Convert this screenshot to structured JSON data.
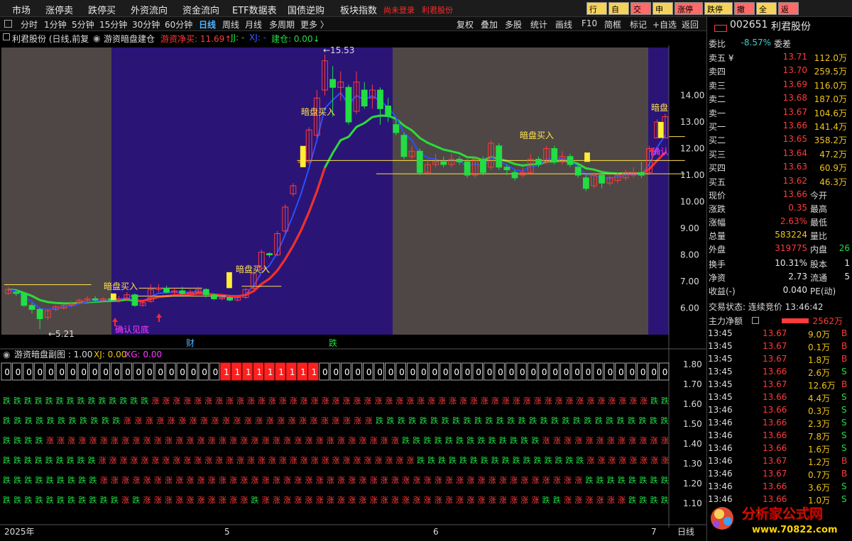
{
  "menubar": {
    "items": [
      "市场",
      "涨停卖",
      "跌停买",
      "外资流向",
      "资金流向",
      "ETF数据表",
      "国债逆购",
      "板块指数"
    ],
    "warning": "尚未登录",
    "stock_short": "利君股份",
    "buttons": [
      {
        "label": "行情",
        "bg": "#f5d35a"
      },
      {
        "label": "自选",
        "bg": "#f5d35a"
      },
      {
        "label": "交易",
        "bg": "#ff6a6a"
      },
      {
        "label": "申新",
        "bg": "#f5d35a"
      },
      {
        "label": "涨停买",
        "bg": "#ff6a6a"
      },
      {
        "label": "跌停卖",
        "bg": "#f5d35a"
      },
      {
        "label": "撤单",
        "bg": "#ff6a6a"
      },
      {
        "label": "全撤",
        "bg": "#f5d35a"
      },
      {
        "label": "返回",
        "bg": "#ff6a6a"
      }
    ]
  },
  "toolbar": {
    "periods": [
      "分时",
      "1分钟",
      "5分钟",
      "15分钟",
      "30分钟",
      "60分钟",
      "日线",
      "周线",
      "月线",
      "多周期",
      "更多 〉"
    ],
    "selected": "日线",
    "right": [
      "复权",
      "叠加",
      "多股",
      "统计",
      "画线",
      "F10",
      "简框",
      "标记",
      "+自选",
      "返回"
    ]
  },
  "chart_header": {
    "title": "利君股份 (日线,前复权)",
    "indicator": "游资暗盘建仓",
    "net_buy_label": "游资净买: 11.69↑",
    "jj": "JJ: -",
    "xj": "XJ: -",
    "build": "建仓: 0.00↓"
  },
  "price_axis": {
    "labels": [
      "14.00",
      "13.00",
      "12.00",
      "11.00",
      "10.00",
      "9.00",
      "8.00",
      "7.00",
      "6.00"
    ]
  },
  "annotations": {
    "high": "←15.53",
    "low": "←5.21",
    "buy": "暗盘买入",
    "confirm_bottom": "确认见底",
    "confirm": "确认",
    "dark": "暗盘",
    "cai": "财",
    "die": "跌"
  },
  "sub_header": {
    "title": "游资暗盘副图 : 1.00",
    "xj": "XJ: 0.00",
    "xg": "XG: 0.00"
  },
  "sub_axis": {
    "labels": [
      "1.80",
      "1.70",
      "1.60",
      "1.50",
      "1.40",
      "1.30",
      "1.20",
      "1.10"
    ]
  },
  "binary_row": "0000000000000000000011111111100000000000000000000000000000000",
  "signal_rows": [
    "GGGGGGGGGGGGGGRRRRRRRRRRRRRRRRRRRRRRRRRRRRRRRRRRRRRRRRRRRRRRRGG",
    "GGGGGGGGGGGRRRRRRRRRRRRRRRRRRRRRRRGGGGGGGGGGGGGGGGGGGGGGGGGGG",
    "GGGGRRRRRRRRRRRRRRRRRRRRRRRRRRRRRRRRRGGGGGGGGGGGGGRRRRRRRRRRRR",
    "GGGGGGGGGRRRRRRRRRRRRRRRRRRRRRRRRRRRRRRGGGGGGGGGGGGGGGGRRRRRRRR",
    "GGGGGGGGGRRRRRRRRRRRRRRRRRRRRRRRRRRRRRRRRRRRRRRRRRRRRRGGGGGGGG",
    "GGGGGGGGGGGRGRRRRRRRRRRGRRRRRRRRRRRRRRRRRRRRRRRRRRGGRRRRRRGGGG"
  ],
  "signal_words": {
    "G": "跌",
    "R": "涨"
  },
  "time_axis": {
    "labels": [
      "2025年",
      "5",
      "6",
      "7"
    ],
    "period": "日线"
  },
  "quote": {
    "code": "002651",
    "name": "利君股份",
    "webi": {
      "label": "委比",
      "value": "-8.57%",
      "label2": "委差"
    },
    "sells": [
      {
        "label": "卖五 ¥",
        "price": "13.71",
        "vol": "112.0万"
      },
      {
        "label": "卖四",
        "price": "13.70",
        "vol": "259.5万"
      },
      {
        "label": "卖三",
        "price": "13.69",
        "vol": "116.0万"
      },
      {
        "label": "卖二",
        "price": "13.68",
        "vol": "187.0万"
      },
      {
        "label": "卖一",
        "price": "13.67",
        "vol": "104.6万"
      }
    ],
    "buys": [
      {
        "label": "买一",
        "price": "13.66",
        "vol": "141.4万"
      },
      {
        "label": "买二",
        "price": "13.65",
        "vol": "358.2万"
      },
      {
        "label": "买三",
        "price": "13.64",
        "vol": "47.2万"
      },
      {
        "label": "买四",
        "price": "13.63",
        "vol": "60.9万"
      },
      {
        "label": "买五",
        "price": "13.62",
        "vol": "46.3万"
      }
    ],
    "stats": [
      {
        "l": "现价",
        "v": "13.66",
        "r": "今开",
        "c": "red"
      },
      {
        "l": "涨跌",
        "v": "0.35",
        "r": "最高",
        "c": "red"
      },
      {
        "l": "涨幅",
        "v": "2.63%",
        "r": "最低",
        "c": "red"
      },
      {
        "l": "总量",
        "v": "583224",
        "r": "量比",
        "c": "yel"
      },
      {
        "l": "外盘",
        "v": "319775",
        "r": "内盘",
        "c": "red",
        "rv": "26"
      }
    ],
    "stats2": [
      {
        "l": "换手",
        "v": "10.31%",
        "r": "股本",
        "rv": "1"
      },
      {
        "l": "净资",
        "v": "2.73",
        "r": "流通",
        "rv": "5"
      },
      {
        "l": "收益(-)",
        "v": "0.040",
        "r": "PE(动)",
        "rv": ""
      }
    ],
    "trade_state": "交易状态: 连续竞价 13:46:42",
    "main_net": {
      "label": "主力净额",
      "value": "2562万"
    },
    "ticks": [
      [
        "13:45",
        "13.67",
        "9.0万",
        "B"
      ],
      [
        "13:45",
        "13.67",
        "0.1万",
        "B"
      ],
      [
        "13:45",
        "13.67",
        "1.8万",
        "B"
      ],
      [
        "13:45",
        "13.66",
        "2.6万",
        "S"
      ],
      [
        "13:45",
        "13.67",
        "12.6万",
        "B"
      ],
      [
        "13:45",
        "13.66",
        "4.4万",
        "S"
      ],
      [
        "13:46",
        "13.66",
        "0.3万",
        "S"
      ],
      [
        "13:46",
        "13.66",
        "2.3万",
        "S"
      ],
      [
        "13:46",
        "13.66",
        "7.8万",
        "S"
      ],
      [
        "13:46",
        "13.66",
        "1.6万",
        "S"
      ],
      [
        "13:46",
        "13.67",
        "1.2万",
        "B"
      ],
      [
        "13:46",
        "13.67",
        "0.7万",
        "B"
      ],
      [
        "13:46",
        "13.66",
        "3.6万",
        "S"
      ],
      [
        "13:46",
        "13.66",
        "1.0万",
        "S"
      ]
    ]
  },
  "watermark": {
    "text": "分析家公式网",
    "url": "www.70822.com"
  },
  "chart_data": {
    "type": "candlestick",
    "ylim": [
      5.0,
      15.8
    ],
    "candles": [
      [
        6.55,
        6.7,
        6.8,
        6.5
      ],
      [
        6.6,
        6.55,
        6.7,
        6.45
      ],
      [
        6.55,
        6.1,
        6.6,
        6.05
      ],
      [
        6.1,
        5.95,
        6.2,
        5.8
      ],
      [
        5.95,
        5.6,
        6.0,
        5.21
      ],
      [
        5.65,
        5.9,
        5.95,
        5.55
      ],
      [
        5.95,
        6.05,
        6.1,
        5.9
      ],
      [
        6.0,
        6.1,
        6.15,
        5.95
      ],
      [
        6.1,
        6.15,
        6.25,
        6.05
      ],
      [
        6.2,
        6.3,
        6.35,
        6.15
      ],
      [
        6.3,
        6.35,
        6.45,
        6.2
      ],
      [
        6.35,
        6.3,
        6.45,
        6.25
      ],
      [
        6.3,
        6.35,
        6.4,
        6.25
      ],
      [
        6.35,
        6.3,
        6.45,
        6.25
      ],
      [
        6.3,
        6.35,
        6.45,
        6.2
      ],
      [
        6.35,
        6.5,
        6.6,
        6.25
      ],
      [
        6.5,
        6.1,
        6.55,
        6.05
      ],
      [
        6.1,
        6.2,
        6.3,
        6.05
      ],
      [
        6.25,
        6.7,
        6.9,
        6.2
      ],
      [
        6.7,
        6.75,
        6.9,
        6.6
      ],
      [
        6.75,
        6.6,
        6.85,
        6.55
      ],
      [
        6.6,
        6.65,
        6.75,
        6.5
      ],
      [
        6.65,
        6.55,
        6.8,
        6.5
      ],
      [
        6.55,
        6.6,
        6.7,
        6.5
      ],
      [
        6.6,
        6.7,
        6.8,
        6.55
      ],
      [
        6.7,
        6.5,
        6.75,
        6.4
      ],
      [
        6.5,
        6.35,
        6.55,
        6.3
      ],
      [
        6.35,
        6.4,
        6.45,
        6.3
      ],
      [
        6.4,
        6.3,
        6.45,
        6.25
      ],
      [
        6.3,
        6.4,
        6.5,
        6.25
      ],
      [
        6.4,
        6.7,
        6.75,
        6.35
      ],
      [
        6.75,
        7.3,
        7.4,
        6.7
      ],
      [
        7.5,
        8.1,
        8.2,
        7.4
      ],
      [
        8.05,
        8.0,
        8.1,
        7.9
      ],
      [
        8.0,
        8.8,
        8.9,
        7.95
      ],
      [
        8.9,
        9.8,
        9.9,
        8.8
      ],
      [
        10.3,
        10.6,
        10.7,
        10.2
      ],
      [
        11.5,
        11.5,
        11.6,
        11.4
      ],
      [
        11.5,
        12.7,
        12.8,
        11.4
      ],
      [
        12.5,
        13.9,
        14.2,
        12.4
      ],
      [
        14.2,
        15.3,
        15.53,
        14.0
      ],
      [
        14.6,
        14.3,
        15.1,
        13.2
      ],
      [
        14.3,
        14.5,
        14.9,
        13.8
      ],
      [
        14.3,
        13.0,
        14.4,
        12.9
      ],
      [
        13.4,
        14.5,
        14.9,
        13.3
      ],
      [
        14.2,
        13.6,
        14.5,
        13.5
      ],
      [
        13.9,
        14.2,
        14.4,
        13.5
      ],
      [
        14.2,
        13.5,
        14.3,
        12.9
      ],
      [
        13.6,
        13.2,
        13.9,
        13.0
      ],
      [
        12.9,
        12.6,
        13.1,
        12.5
      ],
      [
        12.5,
        11.7,
        12.6,
        11.6
      ],
      [
        11.7,
        11.9,
        12.1,
        11.6
      ],
      [
        11.9,
        11.1,
        12.0,
        11.0
      ],
      [
        11.1,
        11.4,
        11.6,
        11.0
      ],
      [
        11.4,
        11.5,
        11.8,
        11.3
      ],
      [
        11.5,
        11.4,
        11.7,
        11.3
      ],
      [
        11.4,
        11.6,
        11.8,
        11.3
      ],
      [
        11.6,
        11.5,
        11.7,
        11.4
      ],
      [
        11.5,
        11.0,
        11.6,
        10.9
      ],
      [
        11.0,
        11.6,
        11.7,
        10.9
      ],
      [
        11.6,
        11.1,
        11.7,
        11.0
      ],
      [
        11.3,
        12.2,
        12.3,
        11.2
      ],
      [
        12.1,
        11.3,
        12.2,
        11.2
      ],
      [
        11.3,
        11.2,
        11.4,
        11.0
      ],
      [
        11.1,
        10.9,
        11.2,
        10.8
      ],
      [
        11.0,
        11.1,
        11.3,
        10.9
      ],
      [
        11.1,
        11.6,
        11.8,
        11.0
      ],
      [
        11.6,
        11.4,
        11.7,
        11.3
      ],
      [
        11.5,
        12.0,
        12.1,
        11.4
      ],
      [
        12.0,
        11.5,
        12.1,
        11.4
      ],
      [
        11.5,
        11.7,
        11.9,
        11.4
      ],
      [
        11.7,
        11.4,
        11.8,
        11.3
      ],
      [
        11.3,
        11.0,
        11.4,
        10.9
      ],
      [
        10.9,
        10.5,
        11.0,
        10.4
      ],
      [
        10.6,
        11.0,
        11.1,
        10.5
      ],
      [
        11.0,
        10.7,
        11.1,
        10.5
      ],
      [
        10.7,
        10.9,
        11.0,
        10.6
      ],
      [
        10.8,
        11.0,
        11.1,
        10.7
      ],
      [
        10.9,
        11.1,
        11.2,
        10.8
      ],
      [
        11.0,
        11.1,
        11.3,
        10.9
      ],
      [
        11.1,
        11.0,
        11.5,
        10.9
      ],
      [
        11.1,
        12.0,
        12.1,
        11.0
      ],
      [
        12.4,
        13.0,
        13.1,
        12.4
      ],
      [
        12.4,
        13.2,
        13.3,
        12.4
      ]
    ]
  }
}
